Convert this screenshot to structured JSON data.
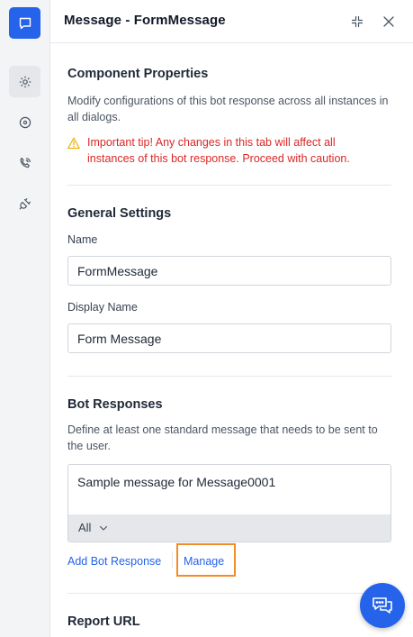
{
  "rail": {
    "items": [
      {
        "icon": "chat-bubble-icon"
      },
      {
        "icon": "gear-icon"
      },
      {
        "icon": "target-icon"
      },
      {
        "icon": "phone-icon"
      },
      {
        "icon": "plug-icon"
      }
    ]
  },
  "header": {
    "title": "Message - FormMessage",
    "collapse_icon": "collapse-icon",
    "close_icon": "close-icon"
  },
  "component_properties": {
    "title": "Component Properties",
    "description": "Modify configurations of this bot response across all instances in all dialogs.",
    "tip": "Important tip! Any changes in this tab will affect all instances of this bot response. Proceed with caution."
  },
  "general_settings": {
    "title": "General Settings",
    "name_label": "Name",
    "name_value": "FormMessage",
    "display_name_label": "Display Name",
    "display_name_value": "Form Message"
  },
  "bot_responses": {
    "title": "Bot Responses",
    "description": "Define at least one standard message that needs to be sent to the user.",
    "message_text": "Sample message for Message0001",
    "channel": "All",
    "add_label": "Add Bot Response",
    "manage_label": "Manage"
  },
  "report_url": {
    "title": "Report URL"
  },
  "colors": {
    "accent": "#2563eb",
    "warning": "#dc2626",
    "highlight": "#f28c28"
  }
}
